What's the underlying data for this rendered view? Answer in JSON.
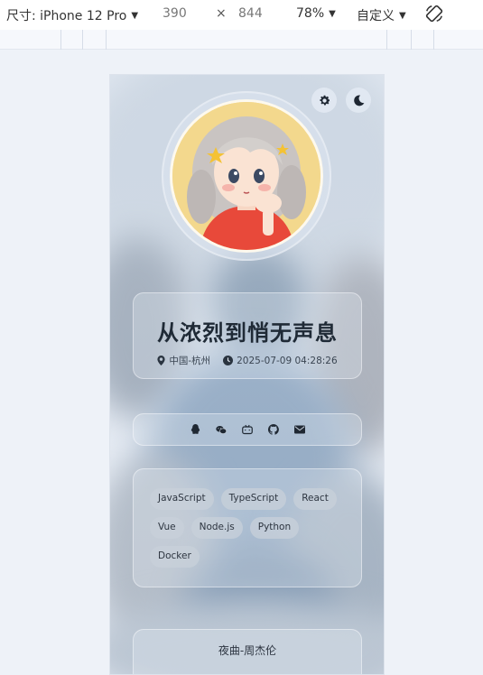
{
  "devtools": {
    "device_label": "尺寸: iPhone 12 Pro",
    "width": "390",
    "times": "×",
    "height": "844",
    "zoom": "78%",
    "throttle": "自定义"
  },
  "profile": {
    "title": "从浓烈到悄无声息",
    "location": "中国-杭州",
    "datetime": "2025-07-09 04:28:26"
  },
  "socials": [
    "qq-icon",
    "wechat-icon",
    "bilibili-icon",
    "github-icon",
    "mail-icon"
  ],
  "tags": [
    "JavaScript",
    "TypeScript",
    "React",
    "Vue",
    "Node.js",
    "Python",
    "Docker"
  ],
  "music": {
    "now_playing": "夜曲-周杰伦"
  }
}
